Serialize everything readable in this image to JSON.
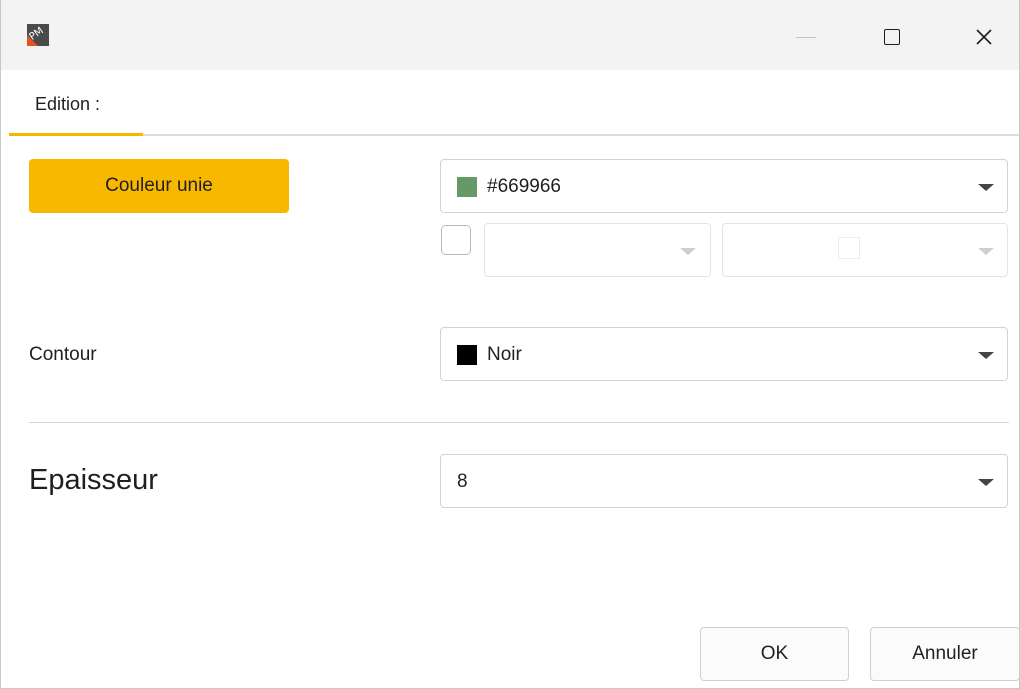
{
  "window": {
    "icon": "app-logo-icon",
    "controls": {
      "minimize_icon": "minimize-icon",
      "maximize_icon": "maximize-icon",
      "close_icon": "close-icon",
      "close_glyph": "✕"
    }
  },
  "tabs": [
    {
      "label": "Edition :",
      "selected": true
    }
  ],
  "fill": {
    "mode_button_label": "Couleur unie",
    "color_combo": {
      "swatch_color": "#669966",
      "value": "#669966"
    },
    "gradient_enabled": false
  },
  "contour": {
    "label": "Contour",
    "combo": {
      "swatch_color": "#000000",
      "value": "Noir"
    }
  },
  "thickness": {
    "label": "Epaisseur",
    "combo": {
      "value": "8"
    }
  },
  "footer": {
    "ok_label": "OK",
    "cancel_label": "Annuler"
  },
  "colors": {
    "accent": "#F8B800",
    "border": "#D2D2D2"
  }
}
